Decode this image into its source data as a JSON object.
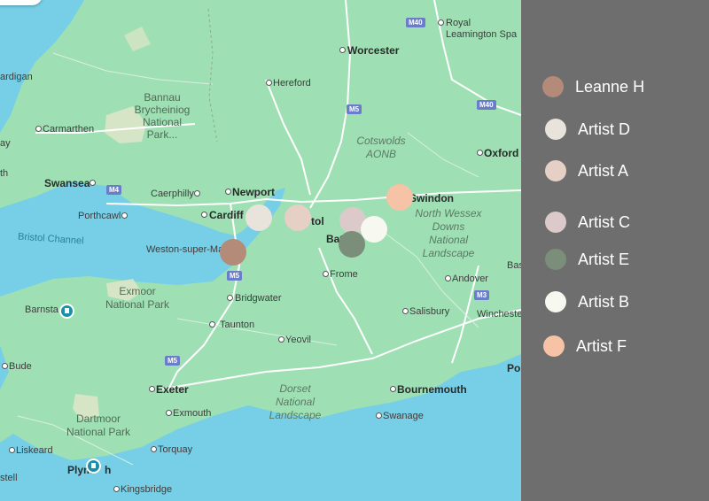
{
  "map": {
    "places": {
      "worcester": "Worcester",
      "royal_leamington": "Royal\nLeamington Spa",
      "hereford": "Hereford",
      "bannau": "Bannau\nBrycheiniog\nNational\nPark...",
      "ardigan": "ardigan",
      "carmarthen": "Carmarthen",
      "cotswolds": "Cotswolds\nAONB",
      "oxford": "Oxford",
      "swansea": "Swansea",
      "caerphilly": "Caerphilly",
      "newport": "Newport",
      "swindon": "Swindon",
      "porthcawl": "Porthcawl",
      "cardiff": "Cardiff",
      "bristol": "tol",
      "bath": "Bat",
      "north_wessex": "North Wessex\nDowns\nNational\nLandscape",
      "bristol_channel": "Bristol Channel",
      "weston": "Weston-super-Ma",
      "frome": "Frome",
      "andover": "Andover",
      "bas": "Bas",
      "exmoor": "Exmoor\nNational Park",
      "bridgwater": "Bridgwater",
      "barnsta": "Barnsta",
      "salisbury": "Salisbury",
      "winchester": "Winchester",
      "taunton": "Taunton",
      "yeovil": "Yeovil",
      "bude": "Bude",
      "exeter": "Exeter",
      "dorset": "Dorset\nNational\nLandscape",
      "bournemouth": "Bournemouth",
      "exmouth": "Exmouth",
      "swanage": "Swanage",
      "dartmoor": "Dartmoor\nNational Park",
      "torquay": "Torquay",
      "liskeard": "Liskeard",
      "plymouth": "Plym",
      "plymouth_tail": "h",
      "kingsbridge": "Kingsbridge",
      "po": "Po",
      "ay": "ay",
      "th": "th",
      "stell": "stell"
    },
    "shields": {
      "m40_north": "M40",
      "m40_south": "M40",
      "m5_north": "M5",
      "m4": "M4",
      "m5_mid": "M5",
      "m5_south": "M5",
      "m3": "M3"
    },
    "colors": {
      "land": "#9ee0b4",
      "sea": "#76cfe6",
      "road": "#ffffff"
    }
  },
  "legend": {
    "items": [
      {
        "label": "Leanne H",
        "color": "#b48a78"
      },
      {
        "label": "Artist D",
        "color": "#e8e4dc"
      },
      {
        "label": "Artist A",
        "color": "#e6cfc4"
      },
      {
        "label": "Artist C",
        "color": "#dcc9c9"
      },
      {
        "label": "Artist E",
        "color": "#7a8e79"
      },
      {
        "label": "Artist B",
        "color": "#f7f8ef"
      },
      {
        "label": "Artist F",
        "color": "#f6c3a6"
      }
    ]
  }
}
